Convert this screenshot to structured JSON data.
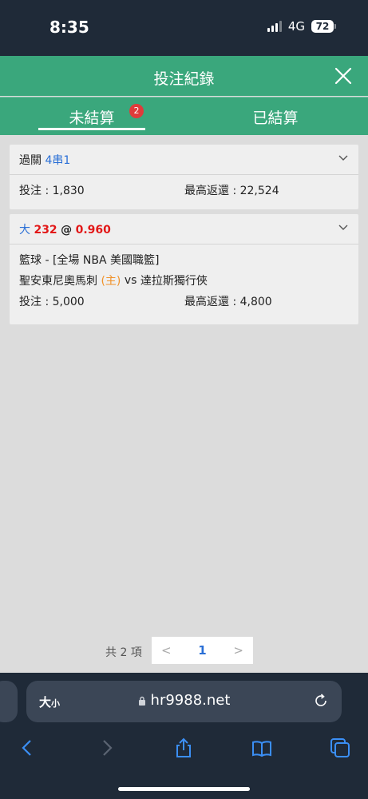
{
  "status": {
    "time": "8:35",
    "network": "4G",
    "battery": "72"
  },
  "header": {
    "title": "投注紀錄"
  },
  "tabs": {
    "open_label": "未結算",
    "open_count": "2",
    "settled_label": "已結算"
  },
  "bets": [
    {
      "type_label": "過關",
      "type_value": "4串1",
      "stake_label": "投注 : 1,830",
      "max_return_label": "最高返還 : 22,524"
    },
    {
      "selection": "大",
      "line": "232",
      "at": "@",
      "odds": "0.960",
      "league": "籃球 - [全場 NBA 美國職籃]",
      "home_team": "聖安東尼奧馬刺",
      "home_marker": "(主)",
      "vs": "vs",
      "away_team": "達拉斯獨行俠",
      "stake_label": "投注 : 5,000",
      "max_return_label": "最高返還 : 4,800"
    }
  ],
  "pagination": {
    "total": "共 2 項",
    "prev": "<",
    "page": "1",
    "next": ">"
  },
  "browser": {
    "text_size": "大",
    "text_size_small": "小",
    "url": "hr9988.net"
  },
  "colors": {
    "brand_green": "#3aa77c",
    "dark": "#1f2a38",
    "accent_blue": "#2a6fd6",
    "odds_red": "#e21818",
    "home_orange": "#f0922a"
  },
  "icons": [
    "close-icon",
    "chevron-down-icon",
    "lock-icon",
    "reload-icon",
    "back-icon",
    "forward-icon",
    "share-icon",
    "bookmarks-icon",
    "tabs-icon"
  ]
}
